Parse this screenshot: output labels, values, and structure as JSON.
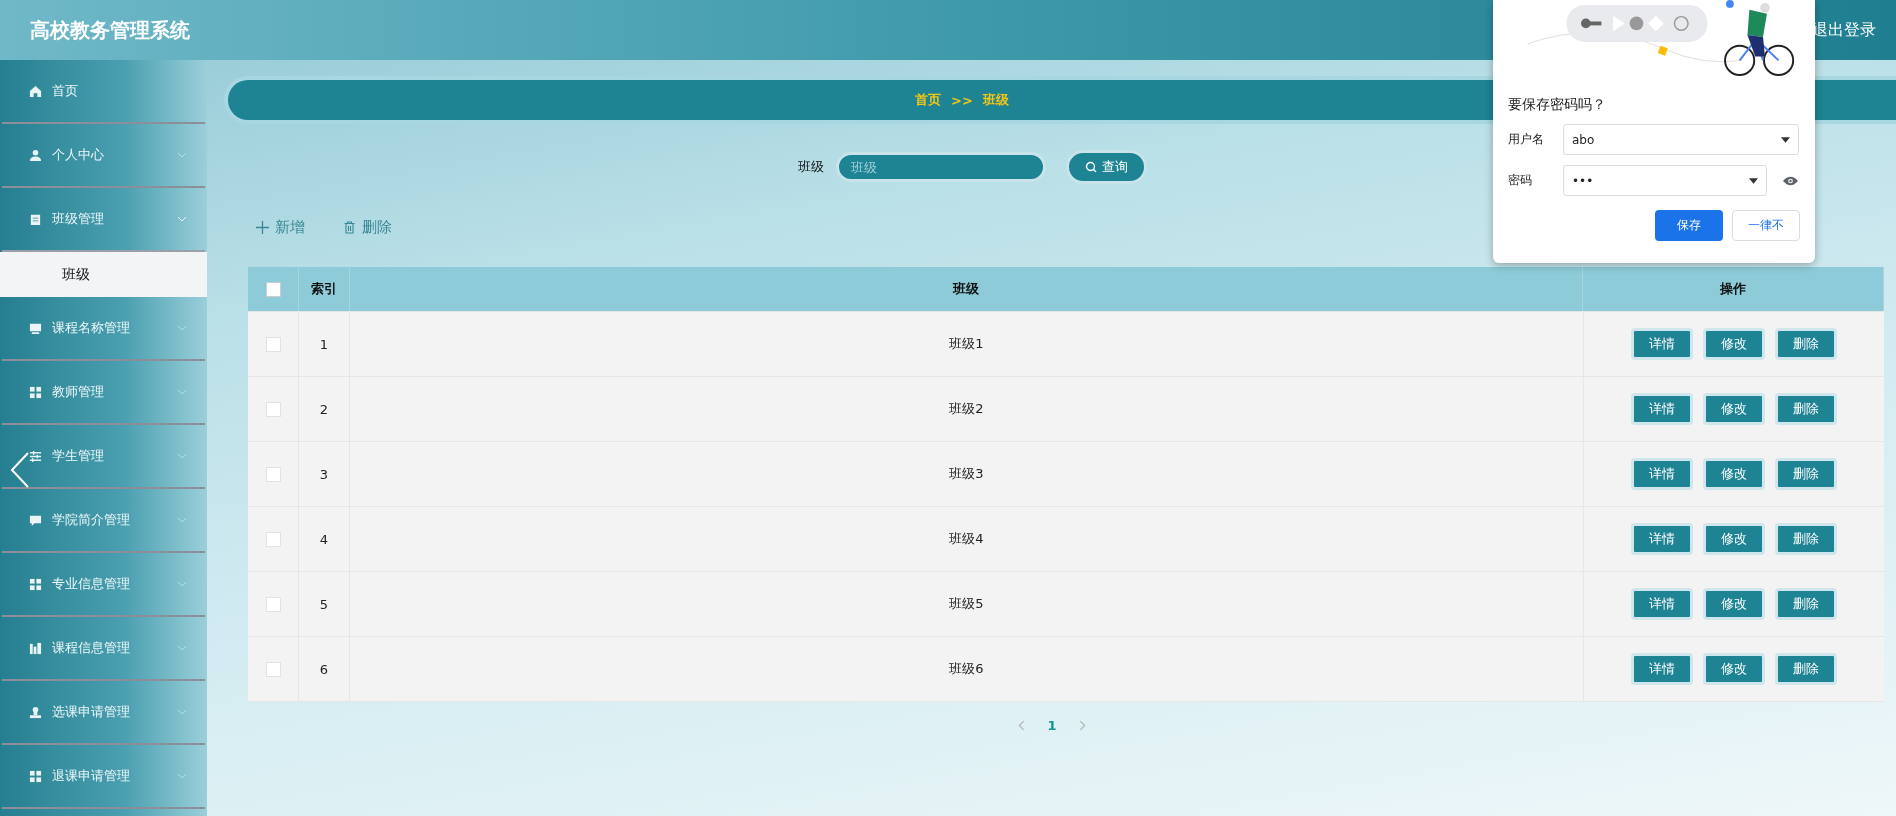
{
  "header": {
    "title": "高校教务管理系统",
    "logout": "退出登录"
  },
  "sidebar": {
    "items": [
      {
        "label": "首页"
      },
      {
        "label": "个人中心",
        "expanded": false
      },
      {
        "label": "班级管理",
        "expanded": true,
        "children": [
          {
            "label": "班级",
            "selected": true
          }
        ]
      },
      {
        "label": "课程名称管理",
        "expanded": false
      },
      {
        "label": "教师管理",
        "expanded": false
      },
      {
        "label": "学生管理",
        "expanded": false
      },
      {
        "label": "学院简介管理",
        "expanded": false
      },
      {
        "label": "专业信息管理",
        "expanded": false
      },
      {
        "label": "课程信息管理",
        "expanded": false
      },
      {
        "label": "选课申请管理",
        "expanded": false
      },
      {
        "label": "退课申请管理",
        "expanded": false
      }
    ]
  },
  "breadcrumb": {
    "home": "首页",
    "separator": ">>",
    "current": "班级"
  },
  "search": {
    "label": "班级",
    "placeholder": "班级",
    "button": "查询"
  },
  "actions": {
    "add": "新增",
    "delete": "删除"
  },
  "table": {
    "columns": [
      "索引",
      "班级",
      "操作"
    ],
    "all_checked": false,
    "rows": [
      {
        "index": "1",
        "name": "班级1",
        "checked": false,
        "actions": [
          "详情",
          "修改",
          "删除"
        ]
      },
      {
        "index": "2",
        "name": "班级2",
        "checked": false,
        "actions": [
          "详情",
          "修改",
          "删除"
        ]
      },
      {
        "index": "3",
        "name": "班级3",
        "checked": false,
        "actions": [
          "详情",
          "修改",
          "删除"
        ]
      },
      {
        "index": "4",
        "name": "班级4",
        "checked": false,
        "actions": [
          "详情",
          "修改",
          "删除"
        ]
      },
      {
        "index": "5",
        "name": "班级5",
        "checked": false,
        "actions": [
          "详情",
          "修改",
          "删除"
        ]
      },
      {
        "index": "6",
        "name": "班级6",
        "checked": false,
        "actions": [
          "详情",
          "修改",
          "删除"
        ]
      }
    ]
  },
  "pagination": {
    "pages": [
      {
        "label": "1",
        "selected": true
      }
    ]
  },
  "password_popup": {
    "title": "要保存密码吗？",
    "username_label": "用户名",
    "username": "abo",
    "password_label": "密码",
    "password": "•••",
    "save": "保存",
    "never": "一律不"
  }
}
